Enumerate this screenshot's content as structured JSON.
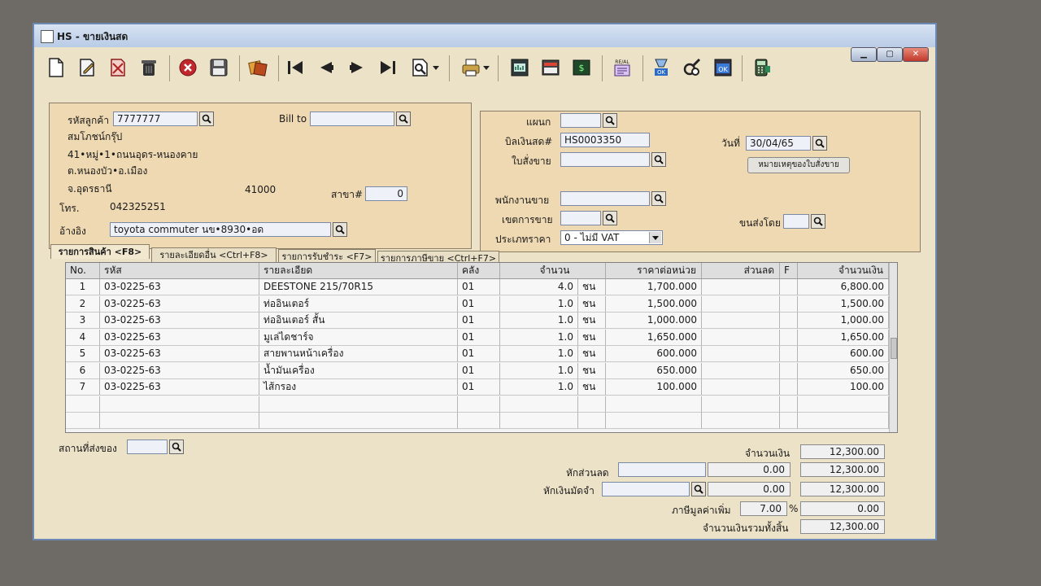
{
  "window": {
    "app_code": "HS",
    "title": "HS - ขายเงินสด"
  },
  "colors": {
    "window_bg": "#ece2c8",
    "panel_bg": "#efd9b2",
    "titlebar": "#c6d6ec"
  },
  "toolbar": {
    "buttons": [
      "new-doc-icon",
      "edit-doc-icon",
      "cancel-doc-icon",
      "trash-icon",
      "close-circle-icon",
      "save-icon",
      "export-icon",
      "first-record-icon",
      "prev-record-icon",
      "next-record-icon",
      "last-record-icon",
      "search-doc-icon",
      "print-icon",
      "report-1-icon",
      "report-2-icon",
      "report-3-icon",
      "recalc-icon",
      "approve-icon",
      "tools-icon",
      "ok-doc-icon",
      "calculator-icon"
    ]
  },
  "customer": {
    "code_label": "รหัสลูกค้า",
    "code": "7777777",
    "bill_to_label": "Bill to",
    "bill_to": "",
    "name": "สมโภชน์กรุ๊ป",
    "addr1": "41•หมู่•1•ถนนอุดร-หนองคาย",
    "addr2": "ต.หนองบัว•อ.เมือง",
    "addr3": "จ.อุดรธานี",
    "postcode": "41000",
    "branch_label": "สาขา#",
    "branch": "0",
    "phone_label": "โทร.",
    "phone": "042325251",
    "ref_label": "อ้างอิง",
    "ref": "toyota commuter นข•8930•อด"
  },
  "document": {
    "dept_label": "แผนก",
    "dept": "",
    "bill_label": "บิลเงินสด#",
    "bill_no": "HS0003350",
    "date_label": "วันที่",
    "date": "30/04/65",
    "so_label": "ใบสั่งขาย",
    "so": "",
    "so_note_button": "หมายเหตุของใบสั่งขาย",
    "salesman_label": "พนักงานขาย",
    "salesman": "",
    "area_label": "เขตการขาย",
    "area": "",
    "ship_label": "ขนส่งโดย",
    "ship": "",
    "price_type_label": "ประเภทราคา",
    "price_type": "0 - ไม่มี VAT"
  },
  "tabs": [
    "รายการสินค้า <F8>",
    "รายละเอียดอื่น <Ctrl+F8>",
    "รายการรับชำระ <F7>",
    "รายการภาษีขาย <Ctrl+F7>"
  ],
  "grid": {
    "headers": [
      "No.",
      "รหัส",
      "รายละเอียด",
      "คลัง",
      "จำนวน",
      "ราคาต่อหน่วย",
      "ส่วนลด",
      "F",
      "จำนวนเงิน"
    ],
    "rows": [
      {
        "no": "1",
        "code": "03-0225-63",
        "desc": "DEESTONE 215/70R15",
        "wh": "01",
        "qty": "4.0",
        "unit": "ชน",
        "price": "1,700.000",
        "disc": "",
        "amount": "6,800.00"
      },
      {
        "no": "2",
        "code": "03-0225-63",
        "desc": "ท่ออินเตอร์",
        "wh": "01",
        "qty": "1.0",
        "unit": "ชน",
        "price": "1,500.000",
        "disc": "",
        "amount": "1,500.00"
      },
      {
        "no": "3",
        "code": "03-0225-63",
        "desc": "ท่ออินเตอร์ สั้น",
        "wh": "01",
        "qty": "1.0",
        "unit": "ชน",
        "price": "1,000.000",
        "disc": "",
        "amount": "1,000.00"
      },
      {
        "no": "4",
        "code": "03-0225-63",
        "desc": "มูเล่ไดชาร์จ",
        "wh": "01",
        "qty": "1.0",
        "unit": "ชน",
        "price": "1,650.000",
        "disc": "",
        "amount": "1,650.00"
      },
      {
        "no": "5",
        "code": "03-0225-63",
        "desc": "สายพานหน้าเครื่อง",
        "wh": "01",
        "qty": "1.0",
        "unit": "ชน",
        "price": "600.000",
        "disc": "",
        "amount": "600.00"
      },
      {
        "no": "6",
        "code": "03-0225-63",
        "desc": "น้ำมันเครื่อง",
        "wh": "01",
        "qty": "1.0",
        "unit": "ชน",
        "price": "650.000",
        "disc": "",
        "amount": "650.00"
      },
      {
        "no": "7",
        "code": "03-0225-63",
        "desc": "ไส้กรอง",
        "wh": "01",
        "qty": "1.0",
        "unit": "ชน",
        "price": "100.000",
        "disc": "",
        "amount": "100.00"
      }
    ]
  },
  "footer": {
    "delivery_label": "สถานที่ส่งของ",
    "delivery": "",
    "amount_label": "จำนวนเงิน",
    "amount": "12,300.00",
    "discount_label": "หักส่วนลด",
    "discount_text": "",
    "discount_value": "0.00",
    "after_discount": "12,300.00",
    "deposit_label": "หักเงินมัดจำ",
    "deposit_text": "",
    "deposit_value": "0.00",
    "after_deposit": "12,300.00",
    "vat_label": "ภาษีมูลค่าเพิ่ม",
    "vat_rate": "7.00",
    "vat_pct": "%",
    "vat_value": "0.00",
    "grand_label": "จำนวนเงินรวมทั้งสิ้น",
    "grand_total": "12,300.00"
  }
}
